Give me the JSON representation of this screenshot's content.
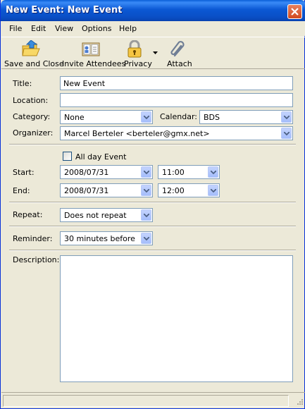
{
  "window": {
    "title": "New Event: New Event"
  },
  "menu": {
    "file": "File",
    "edit": "Edit",
    "view": "View",
    "options": "Options",
    "help": "Help"
  },
  "toolbar": {
    "save_close": "Save and Close",
    "invite": "Invite Attendees",
    "privacy": "Privacy",
    "attach": "Attach"
  },
  "form": {
    "title_label": "Title:",
    "title_value": "New Event",
    "location_label": "Location:",
    "location_value": "",
    "category_label": "Category:",
    "category_value": "None",
    "calendar_label": "Calendar:",
    "calendar_value": "BDS",
    "organizer_label": "Organizer:",
    "organizer_value": "Marcel Berteler <berteler@gmx.net>",
    "allday_label": "All day Event",
    "allday_checked": false,
    "start_label": "Start:",
    "start_date": "2008/07/31",
    "start_time": "11:00",
    "end_label": "End:",
    "end_date": "2008/07/31",
    "end_time": "12:00",
    "repeat_label": "Repeat:",
    "repeat_value": "Does not repeat",
    "reminder_label": "Reminder:",
    "reminder_value": "30 minutes before",
    "description_label": "Description:",
    "description_value": ""
  },
  "colors": {
    "titlebar": "#0A5FD8",
    "face": "#ECE9D8",
    "close": "#D24A1E"
  }
}
